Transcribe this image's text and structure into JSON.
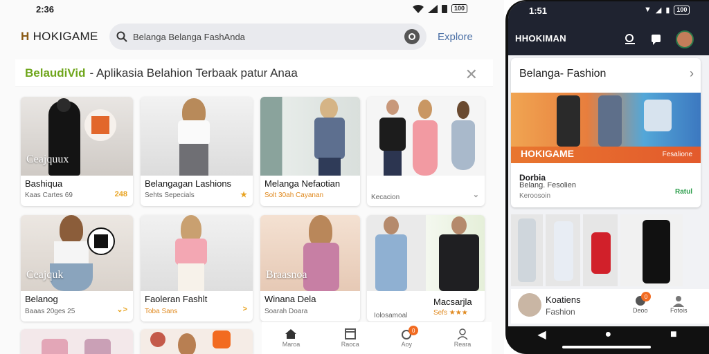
{
  "left": {
    "status_time": "2:36",
    "battery": "100",
    "brand": "HOKIGAME",
    "search_text": "Belanga Belanga FashAnda",
    "explore_label": "Explore",
    "banner_brand": "BelaudiVid",
    "banner_text": "- Aplikasia Belahion Terbaak patur Anaa",
    "cards": [
      {
        "overlay": "Ceajquux",
        "title": "Bashiqua",
        "sub": "Kaas Cartes  69",
        "badge": "248",
        "sub_orange": false
      },
      {
        "overlay": "",
        "title": "Belangagan Lashions",
        "sub": "Sehts Sepecials",
        "badge": "★",
        "sub_orange": false
      },
      {
        "overlay": "",
        "title": "Melanga Nefaotian",
        "sub": "Solt 30ah Cayanan",
        "badge": "",
        "sub_orange": true
      },
      {
        "overlay": "",
        "title": "",
        "sub": "Kecacion",
        "badge": "⌄",
        "sub_orange": false
      },
      {
        "overlay": "Ceajquk",
        "title": "Belanog",
        "sub": "Baaas 20ges  25",
        "badge": "⌄>",
        "sub_orange": false
      },
      {
        "overlay": "",
        "title": "Faoleran Fashlt",
        "sub": "Toba Sans",
        "badge": ">",
        "sub_orange": true
      },
      {
        "overlay": "Braasnoa",
        "title": "Winana Dela",
        "sub": "Soarah Doara",
        "badge": "",
        "sub_orange": false
      },
      {
        "overlay": "",
        "title": "Macsarjla",
        "sub": "Sefs ★★★",
        "badge": "",
        "sub_orange": false
      },
      {
        "overlay": "",
        "title": "Iolosamoal",
        "sub": "",
        "badge": "",
        "sub_orange": false
      }
    ],
    "nav": [
      {
        "label": "Maroa",
        "badge": ""
      },
      {
        "label": "Raoca",
        "badge": ""
      },
      {
        "label": "Aoy",
        "badge": "0"
      },
      {
        "label": "Reara",
        "badge": ""
      }
    ],
    "nav_badge": "0"
  },
  "phone": {
    "status_time": "1:51",
    "battery": "100",
    "brand": "HHOKIMAN",
    "card_title": "Belanga- Fashion",
    "hero_brand": "HOKIGAME",
    "hero_tag": "Fesalione",
    "c_line1": "Dorbia",
    "c_line2": "Belang. Fesolien",
    "c_line3": "Keroosoin",
    "c_tag": "Ratul",
    "bottom_name": "Koatiens",
    "bottom_sub": "Fashion",
    "act1": "Deoo",
    "act2": "Fotois",
    "act_badge": "0"
  },
  "colors": {
    "accent_orange": "#f26b21",
    "banner_green": "#6fa61c",
    "header_dark": "#1f2330",
    "brand_brown": "#8a5a14"
  }
}
